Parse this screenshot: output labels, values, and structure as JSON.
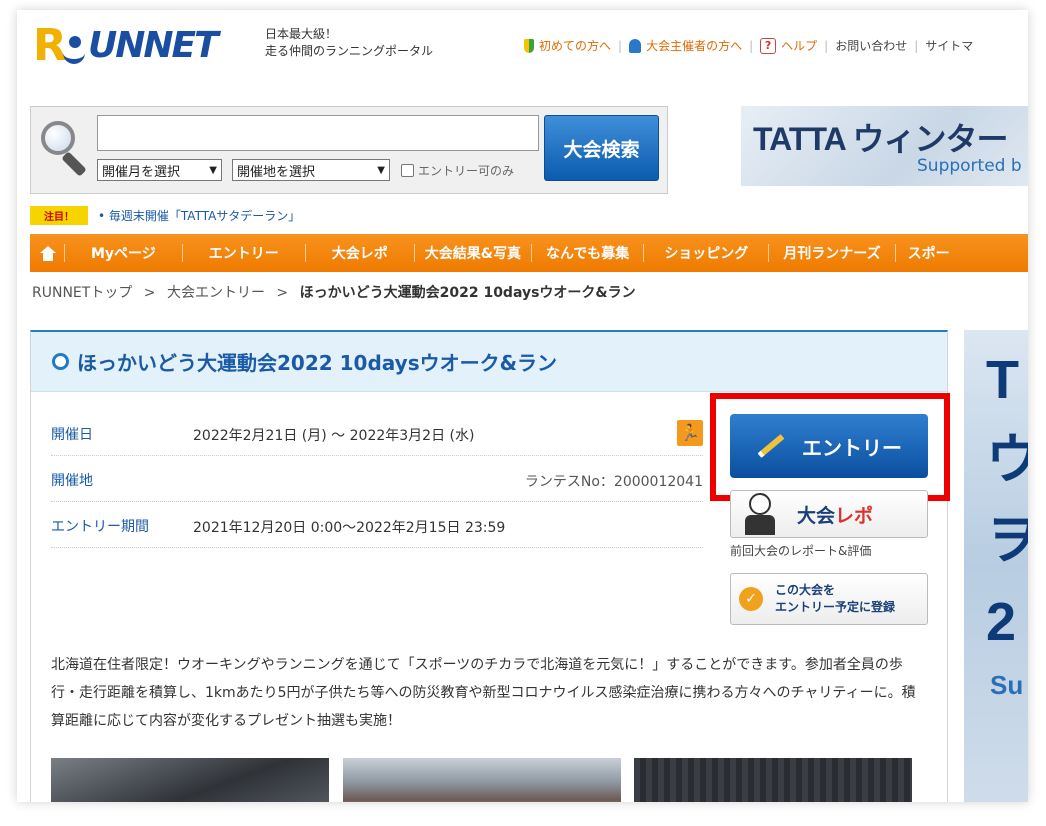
{
  "header": {
    "logo_text": "RUNNET",
    "tagline_1": "日本最大級！",
    "tagline_2": "走る仲間のランニングポータル",
    "links": {
      "first_time": "初めての方へ",
      "organizers": "大会主催者の方へ",
      "help": "ヘルプ",
      "contact": "お問い合わせ",
      "sitemap": "サイトマ"
    }
  },
  "search": {
    "input_value": "",
    "month_select": "開催月を選択",
    "area_select": "開催地を選択",
    "entry_only_label": "エントリー可のみ",
    "button_label": "大会検索"
  },
  "banner_top": {
    "title": "TATTA ウィンター",
    "subtitle": "Supported b"
  },
  "notice": {
    "badge": "注目！",
    "link": "毎週末開催「TATTAサタデーラン」"
  },
  "mainnav": {
    "items": [
      "Myページ",
      "エントリー",
      "大会レポ",
      "大会結果&写真",
      "なんでも募集",
      "ショッピング",
      "月刊ランナーズ",
      "スポー"
    ]
  },
  "breadcrumb": {
    "home": "RUNNETトップ",
    "section": "大会エントリー",
    "current": "ほっかいどう大運動会2022 10daysウオーク&ラン",
    "separator": ">"
  },
  "event": {
    "title": "ほっかいどう大運動会2022 10daysウオーク&ラン",
    "date_label": "開催日",
    "date_value": "2022年2月21日 (月) ～ 2022年3月2日 (水)",
    "venue_label": "開催地",
    "runtes_no": "ランテスNo：2000012041",
    "entry_period_label": "エントリー期間",
    "entry_period_value": "2021年12月20日 0:00～2022年2月15日 23:59",
    "description": "北海道在住者限定！ウオーキングやランニングを通じて「スポーツのチカラで北海道を元気に！」することができます。参加者全員の歩行・走行距離を積算し、1kmあたり5円が子供たち等への防災教育や新型コロナウイルス感染症治療に携わる方々へのチャリティーに。積算距離に応じて内容が変化するプレゼント抽選も実施！"
  },
  "actions": {
    "entry_button": "エントリー",
    "report_button_main": "大会",
    "report_button_accent": "レポ",
    "report_note": "前回大会のレポート&評価",
    "plan_line1": "この大会を",
    "plan_line2": "エントリー予定に登録"
  },
  "banner_right": {
    "chars": [
      "T",
      "ウ",
      "ヲ",
      "2"
    ],
    "sub": "Su"
  },
  "colors": {
    "brand_blue": "#1a5aa6",
    "nav_orange": "#ef7a00",
    "highlight_red": "#ee0000"
  }
}
